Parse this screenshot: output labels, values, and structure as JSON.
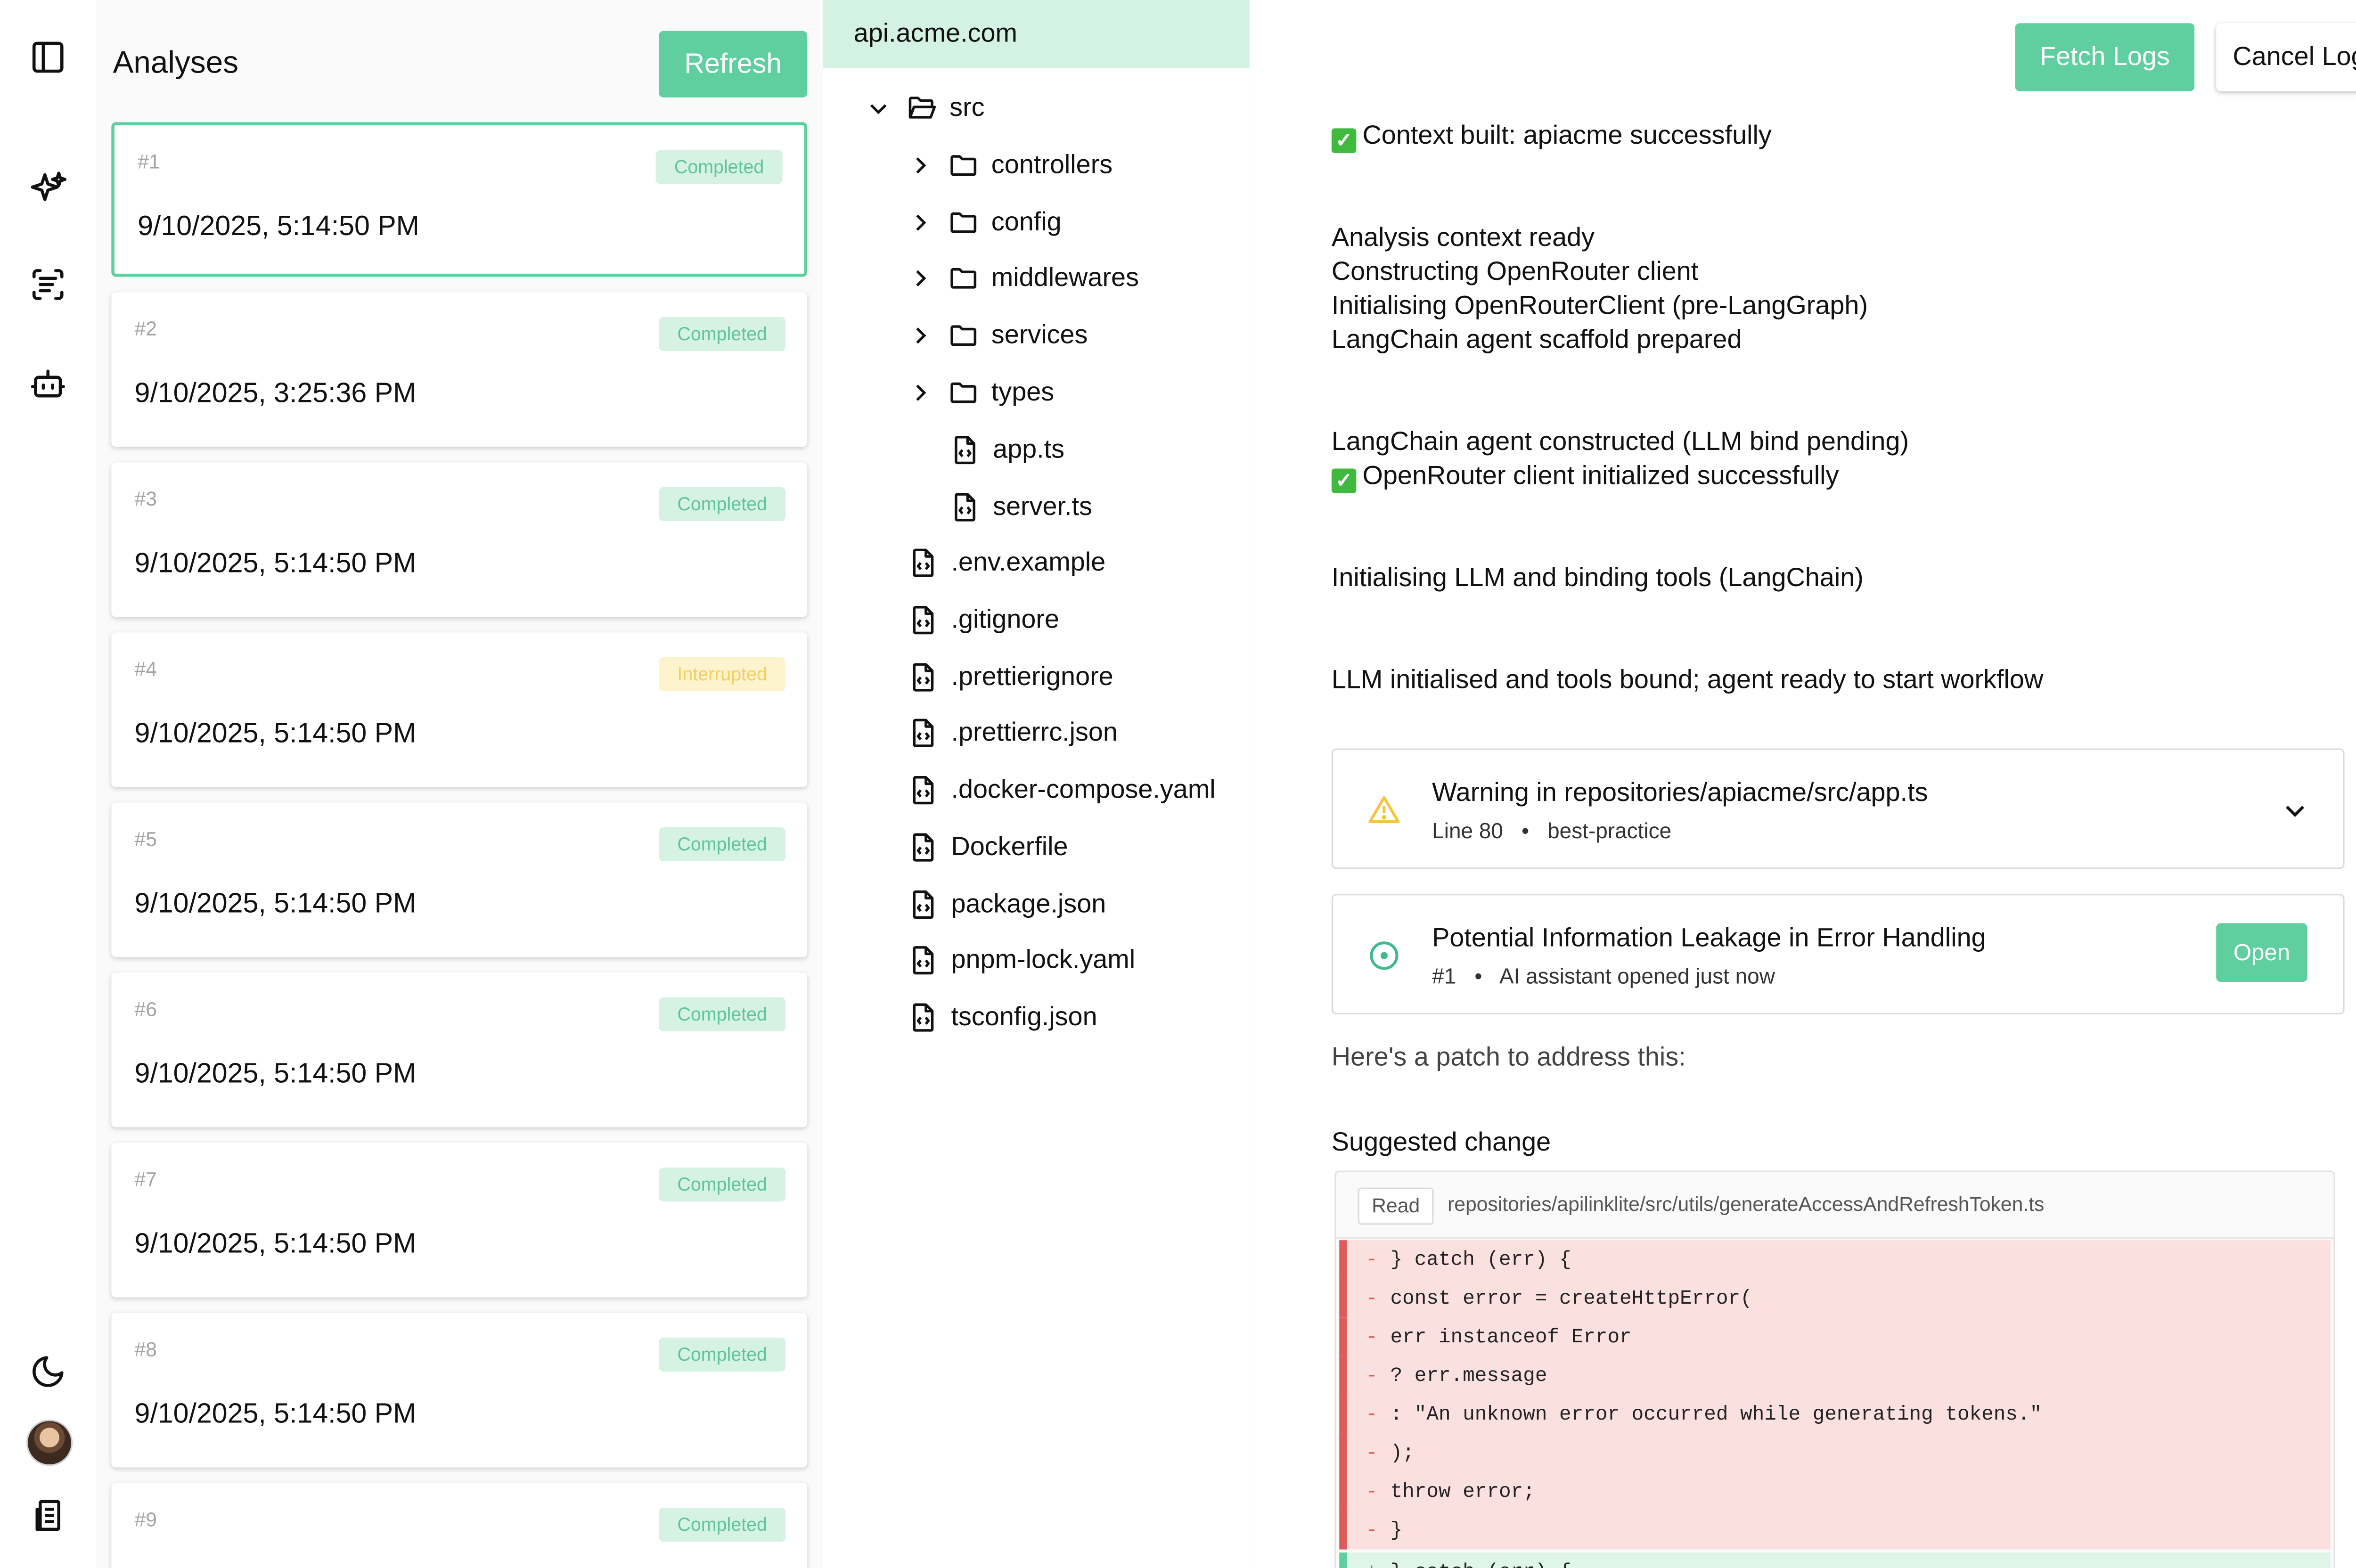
{
  "analyses": {
    "title": "Analyses",
    "refresh_label": "Refresh",
    "cards": [
      {
        "num": "#1",
        "status": "Completed",
        "date": "9/10/2025, 5:14:50 PM"
      },
      {
        "num": "#2",
        "status": "Completed",
        "date": "9/10/2025, 3:25:36 PM"
      },
      {
        "num": "#3",
        "status": "Completed",
        "date": "9/10/2025, 5:14:50 PM"
      },
      {
        "num": "#4",
        "status": "Interrupted",
        "date": "9/10/2025, 5:14:50 PM"
      },
      {
        "num": "#5",
        "status": "Completed",
        "date": "9/10/2025, 5:14:50 PM"
      },
      {
        "num": "#6",
        "status": "Completed",
        "date": "9/10/2025, 5:14:50 PM"
      },
      {
        "num": "#7",
        "status": "Completed",
        "date": "9/10/2025, 5:14:50 PM"
      },
      {
        "num": "#8",
        "status": "Completed",
        "date": "9/10/2025, 5:14:50 PM"
      },
      {
        "num": "#9",
        "status": "Completed",
        "date": ""
      }
    ]
  },
  "tree": {
    "repo": "api.acme.com",
    "nodes": [
      {
        "label": "src",
        "kind": "folder-open"
      },
      {
        "label": "controllers",
        "kind": "folder"
      },
      {
        "label": "config",
        "kind": "folder"
      },
      {
        "label": "middlewares",
        "kind": "folder"
      },
      {
        "label": "services",
        "kind": "folder"
      },
      {
        "label": "types",
        "kind": "folder"
      },
      {
        "label": "app.ts",
        "kind": "file"
      },
      {
        "label": "server.ts",
        "kind": "file"
      },
      {
        "label": ".env.example",
        "kind": "file"
      },
      {
        "label": ".gitignore",
        "kind": "file"
      },
      {
        "label": ".prettierignore",
        "kind": "file"
      },
      {
        "label": ".prettierrc.json",
        "kind": "file"
      },
      {
        "label": ".docker-compose.yaml",
        "kind": "file"
      },
      {
        "label": "Dockerfile",
        "kind": "file"
      },
      {
        "label": "package.json",
        "kind": "file"
      },
      {
        "label": "pnpm-lock.yaml",
        "kind": "file"
      },
      {
        "label": "tsconfig.json",
        "kind": "file"
      }
    ]
  },
  "logs": {
    "fetch_label": "Fetch Logs",
    "cancel_label": "Cancel Logs",
    "lines": [
      "Context  built: apiacme successfully",
      "Analysis context ready",
      "Constructing OpenRouter client",
      "Initialising OpenRouterClient (pre-LangGraph)",
      "LangChain agent scaffold prepared",
      "LangChain agent constructed (LLM bind pending)",
      "OpenRouter client initialized successfully",
      "Initialising LLM and binding tools (LangChain)",
      "LLM initialised and tools bound; agent ready to start workflow"
    ],
    "warning": {
      "title": "Warning in repositories/apiacme/src/app.ts",
      "line": "Line 80",
      "separator": "•",
      "category": "best-practice"
    },
    "issue": {
      "title": "Potential Information Leakage in Error Handling",
      "num": "#1",
      "separator": "•",
      "meta": "AI assistant opened just now",
      "open_label": "Open"
    },
    "patch_intro": "Here's a patch to address this:",
    "suggested_label": "Suggested change",
    "diff": {
      "tag": "Read",
      "path": "repositories/apilinklite/src/utils/generateAccessAndRefreshToken.ts",
      "removed": [
        "} catch (err) {",
        "const error = createHttpError(",
        "err instanceof Error",
        "? err.message",
        ": \"An unknown error occurred while generating tokens.\"",
        ");",
        "throw error;",
        "}"
      ],
      "added": [
        "} catch (err) {"
      ],
      "minus": "-",
      "plus": "+"
    }
  },
  "colors": {
    "accent": "#5fcf9f",
    "accent_light": "#d3f2e4",
    "warning": "#f4c542",
    "removed_bg": "#fbe0e0",
    "removed_bar": "#e05a5a"
  }
}
